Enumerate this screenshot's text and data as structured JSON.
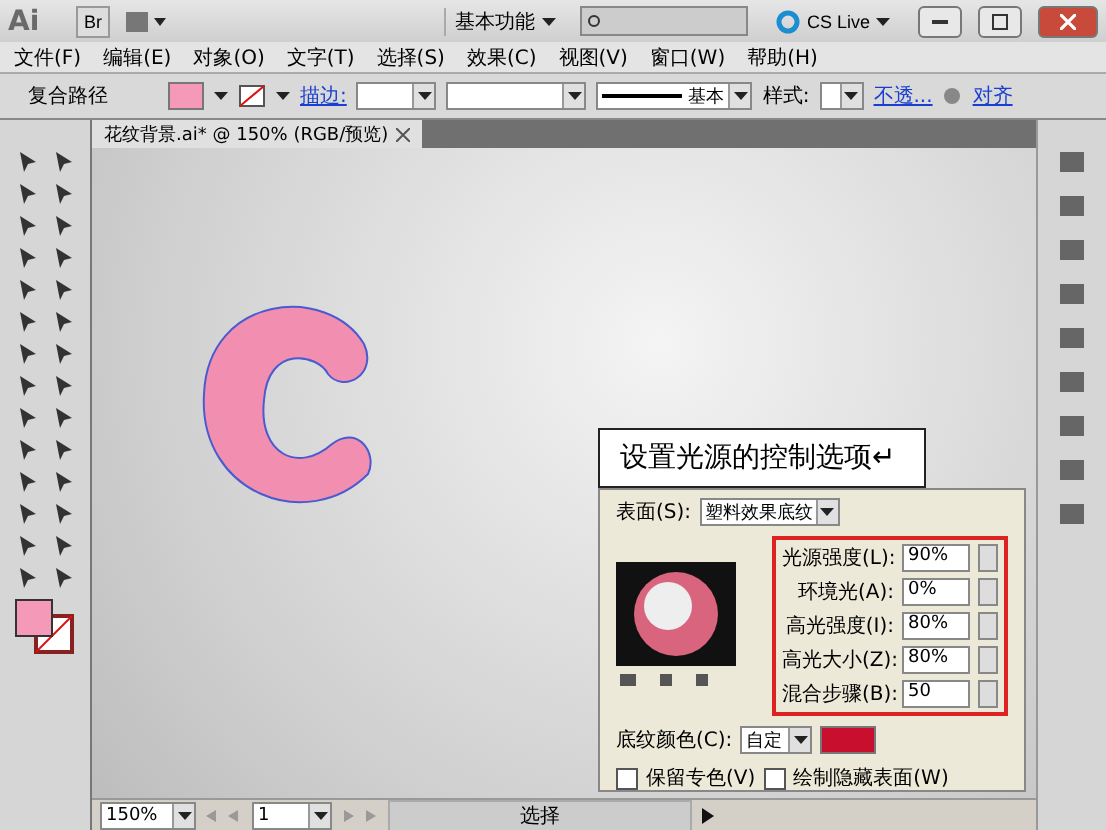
{
  "title_bar": {
    "logo": "Ai",
    "bridge_button": "Br",
    "workspace": "基本功能",
    "cs_live": "CS Live"
  },
  "menu_bar": [
    "文件(F)",
    "编辑(E)",
    "对象(O)",
    "文字(T)",
    "选择(S)",
    "效果(C)",
    "视图(V)",
    "窗口(W)",
    "帮助(H)"
  ],
  "control_bar": {
    "selection_label": "复合路径",
    "stroke_link": "描边:",
    "stroke_profile": "基本",
    "style_label": "样式:",
    "opacity_link": "不透...",
    "align_link": "对齐"
  },
  "document_tab": {
    "title": "花纹背景.ai* @ 150% (RGB/预览)"
  },
  "caption": "设置光源的控制选项↵",
  "dialog": {
    "surface_label": "表面(S):",
    "surface_value": "塑料效果底纹",
    "fields": [
      {
        "label": "光源强度(L):",
        "value": "90%"
      },
      {
        "label": "环境光(A):",
        "value": "0%"
      },
      {
        "label": "高光强度(I):",
        "value": "80%"
      },
      {
        "label": "高光大小(Z):",
        "value": "80%"
      },
      {
        "label": "混合步骤(B):",
        "value": "50"
      }
    ],
    "shading_label": "底纹颜色(C):",
    "shading_value": "自定",
    "checkboxes": [
      {
        "label": "保留专色(V)",
        "checked": false
      },
      {
        "label": "绘制隐藏表面(W)",
        "checked": false
      }
    ]
  },
  "status_bar": {
    "zoom": "150%",
    "page": "1",
    "status": "选择"
  }
}
